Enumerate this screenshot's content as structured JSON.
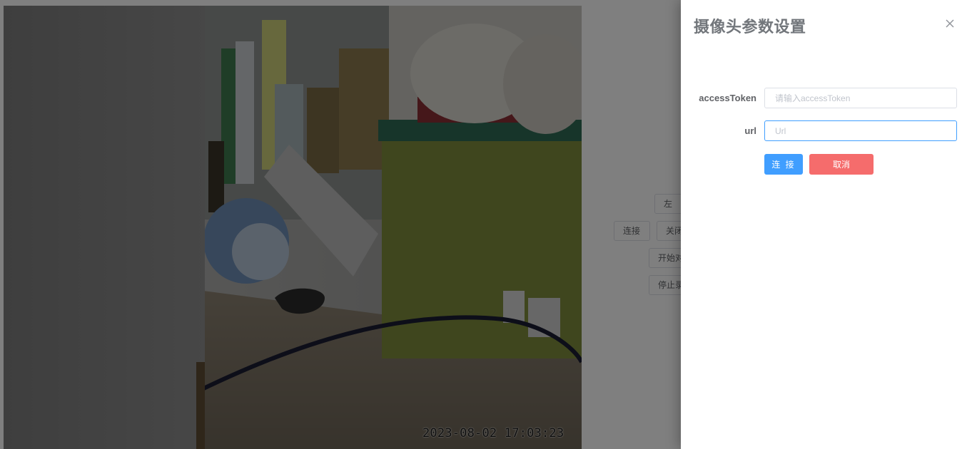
{
  "video": {
    "timestamp": "2023-08-02 17:03:23"
  },
  "controls": {
    "left_label": "左",
    "connect_label": "连接",
    "close_label": "关闭",
    "start_label": "开始对",
    "stop_label": "停止录"
  },
  "drawer": {
    "title": "摄像头参数设置",
    "close_icon": "close-icon",
    "fields": {
      "access_token": {
        "label": "accessToken",
        "placeholder": "请输入accessToken",
        "value": ""
      },
      "url": {
        "label": "url",
        "placeholder": "Url",
        "value": ""
      }
    },
    "buttons": {
      "connect_label": "连 接",
      "cancel_label": "取消"
    }
  },
  "colors": {
    "primary": "#409eff",
    "danger": "#f56c6c",
    "mask": "rgba(0,0,0,0.5)"
  }
}
